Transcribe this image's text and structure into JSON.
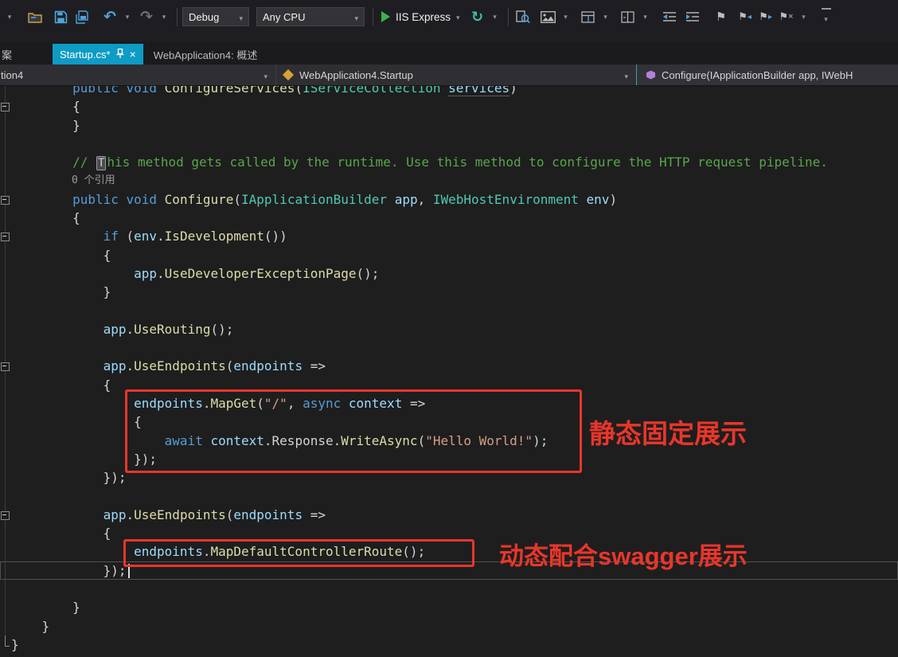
{
  "toolbar": {
    "config": "Debug",
    "platform": "Any CPU",
    "run": "IIS Express"
  },
  "tabs": {
    "cropped_label": "案",
    "active_label": "Startup.cs*",
    "inactive_label": "WebApplication4: 概述",
    "close_glyph": "×"
  },
  "navbar": {
    "project": "tion4",
    "type": "WebApplication4.Startup",
    "member": "Configure(IApplicationBuilder app, IWebH"
  },
  "annotations": {
    "static_label": "静态固定展示",
    "dynamic_label": "动态配合swagger展示",
    "box_color": "#e8362a"
  },
  "colors": {
    "active_tab": "#0e9bc4",
    "editor_bg": "#1e1e1e",
    "annotation_red": "#e8362a"
  },
  "editor": {
    "codelens": "0 个引用",
    "lines": [
      {
        "tokens": [
          [
            "p",
            "        "
          ],
          [
            "k",
            "public"
          ],
          [
            "p",
            " "
          ],
          [
            "k",
            "void"
          ],
          [
            "p",
            " "
          ],
          [
            "m",
            "ConfigureServices"
          ],
          [
            "p",
            "("
          ],
          [
            "t",
            "IServiceCollection"
          ],
          [
            "p",
            " "
          ],
          [
            "u",
            "services"
          ],
          [
            "p",
            ")"
          ]
        ]
      },
      {
        "fold": true,
        "tokens": [
          [
            "p",
            "        {"
          ]
        ]
      },
      {
        "tokens": [
          [
            "p",
            "        }"
          ]
        ]
      },
      {
        "tokens": []
      },
      {
        "tokens": [
          [
            "p",
            "        "
          ],
          [
            "c",
            "// "
          ],
          [
            "box",
            "T"
          ],
          [
            "c",
            "his method gets called by the runtime. Use this method to configure the HTTP request pipeline."
          ]
        ]
      },
      {
        "cls": "codelens",
        "tokens": [
          [
            "cl",
            "0 个引用"
          ]
        ]
      },
      {
        "fold": true,
        "tokens": [
          [
            "p",
            "        "
          ],
          [
            "k",
            "public"
          ],
          [
            "p",
            " "
          ],
          [
            "k",
            "void"
          ],
          [
            "p",
            " "
          ],
          [
            "m",
            "Configure"
          ],
          [
            "p",
            "("
          ],
          [
            "t",
            "IApplicationBuilder"
          ],
          [
            "p",
            " "
          ],
          [
            "v",
            "app"
          ],
          [
            "p",
            ", "
          ],
          [
            "t",
            "IWebHostEnvironment"
          ],
          [
            "p",
            " "
          ],
          [
            "v",
            "env"
          ],
          [
            "p",
            ")"
          ]
        ]
      },
      {
        "tokens": [
          [
            "p",
            "        {"
          ]
        ]
      },
      {
        "fold": true,
        "tokens": [
          [
            "p",
            "            "
          ],
          [
            "k",
            "if"
          ],
          [
            "p",
            " ("
          ],
          [
            "v",
            "env"
          ],
          [
            "p",
            "."
          ],
          [
            "m",
            "IsDevelopment"
          ],
          [
            "p",
            "())"
          ]
        ]
      },
      {
        "tokens": [
          [
            "p",
            "            {"
          ]
        ]
      },
      {
        "tokens": [
          [
            "p",
            "                "
          ],
          [
            "v",
            "app"
          ],
          [
            "p",
            "."
          ],
          [
            "m",
            "UseDeveloperExceptionPage"
          ],
          [
            "p",
            "();"
          ]
        ]
      },
      {
        "tokens": [
          [
            "p",
            "            }"
          ]
        ]
      },
      {
        "tokens": []
      },
      {
        "tokens": [
          [
            "p",
            "            "
          ],
          [
            "v",
            "app"
          ],
          [
            "p",
            "."
          ],
          [
            "m",
            "UseRouting"
          ],
          [
            "p",
            "();"
          ]
        ]
      },
      {
        "tokens": []
      },
      {
        "fold": true,
        "tokens": [
          [
            "p",
            "            "
          ],
          [
            "v",
            "app"
          ],
          [
            "p",
            "."
          ],
          [
            "m",
            "UseEndpoints"
          ],
          [
            "p",
            "("
          ],
          [
            "v",
            "endpoints"
          ],
          [
            "p",
            " =>"
          ]
        ]
      },
      {
        "tokens": [
          [
            "p",
            "            {"
          ]
        ]
      },
      {
        "tokens": [
          [
            "p",
            "                "
          ],
          [
            "v",
            "endpoints"
          ],
          [
            "p",
            "."
          ],
          [
            "m",
            "MapGet"
          ],
          [
            "p",
            "("
          ],
          [
            "s",
            "\"/\""
          ],
          [
            "p",
            ", "
          ],
          [
            "k",
            "async"
          ],
          [
            "p",
            " "
          ],
          [
            "v",
            "context"
          ],
          [
            "p",
            " =>"
          ]
        ]
      },
      {
        "tokens": [
          [
            "p",
            "                {"
          ]
        ]
      },
      {
        "tokens": [
          [
            "p",
            "                    "
          ],
          [
            "k",
            "await"
          ],
          [
            "p",
            " "
          ],
          [
            "v",
            "context"
          ],
          [
            "p",
            ".Response."
          ],
          [
            "m",
            "WriteAsync"
          ],
          [
            "p",
            "("
          ],
          [
            "s",
            "\"Hello World!\""
          ],
          [
            "p",
            ");"
          ]
        ]
      },
      {
        "tokens": [
          [
            "p",
            "                });"
          ]
        ]
      },
      {
        "tokens": [
          [
            "p",
            "            });"
          ]
        ]
      },
      {
        "tokens": []
      },
      {
        "fold": true,
        "tokens": [
          [
            "p",
            "            "
          ],
          [
            "v",
            "app"
          ],
          [
            "p",
            "."
          ],
          [
            "m",
            "UseEndpoints"
          ],
          [
            "p",
            "("
          ],
          [
            "v",
            "endpoints"
          ],
          [
            "p",
            " =>"
          ]
        ]
      },
      {
        "tokens": [
          [
            "p",
            "            {"
          ]
        ]
      },
      {
        "tokens": [
          [
            "p",
            "                "
          ],
          [
            "v",
            "endpoints"
          ],
          [
            "p",
            "."
          ],
          [
            "m",
            "MapDefaultControllerRoute"
          ],
          [
            "p",
            "();"
          ]
        ]
      },
      {
        "cur": true,
        "tokens": [
          [
            "p",
            "            });"
          ],
          [
            "cur",
            ""
          ]
        ]
      },
      {
        "tokens": []
      },
      {
        "tokens": [
          [
            "p",
            "        }"
          ]
        ]
      },
      {
        "tokens": [
          [
            "p",
            "    }"
          ]
        ]
      },
      {
        "foldEnd": true,
        "tokens": [
          [
            "p",
            "}"
          ]
        ]
      }
    ]
  }
}
